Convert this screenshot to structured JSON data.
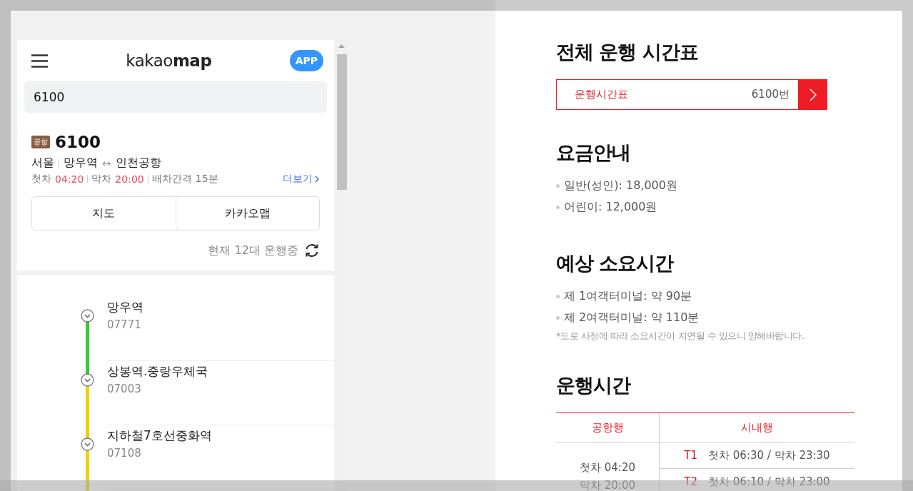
{
  "header": {
    "logo": "kakao**map**",
    "app_button": "APP"
  },
  "search": {
    "value": "6100"
  },
  "route": {
    "badge": "공항",
    "number": "6100",
    "region": "서울",
    "from": "망우역",
    "arrow": "↔",
    "to": "인천공항",
    "schedule": [
      {
        "label": "첫차",
        "value": "04:20",
        "highlight": true
      },
      {
        "label": "막차",
        "value": "20:00",
        "highlight": true
      },
      {
        "label": "배차간격",
        "value": "15분",
        "highlight": false
      }
    ],
    "more": "더보기"
  },
  "buttons": [
    "지도",
    "카카오맵"
  ],
  "status": "현재 12대 운행중",
  "stops": [
    {
      "name": "망우역",
      "id": "07771",
      "color": "#33cc33"
    },
    {
      "name": "상봉역.중랑우체국",
      "id": "07003",
      "color": "#f2d000"
    },
    {
      "name": "지하철7호선중화역",
      "id": "07108",
      "color": "#f2d000"
    }
  ],
  "timetable": {
    "title": "전체 운행 시간표",
    "label": "운행시간표",
    "route": "6100번"
  },
  "fares": {
    "title": "요금안내",
    "items": [
      "일반(성인): 18,000원",
      "어린이: 12,000원"
    ]
  },
  "duration": {
    "title": "예상 소요시간",
    "items": [
      "제 1여객터미널: 약 90분",
      "제 2여객터미널: 약 110분"
    ],
    "note": "*도로 사정에 따라 소요시간이 지연될 수 있으니 양해바랍니다."
  },
  "hours": {
    "title": "운행시간",
    "columns": [
      "공항행",
      "시내행"
    ],
    "airbound": [
      "첫차 04:20",
      "막차 20:00"
    ],
    "citybound": [
      {
        "terminal": "T1",
        "times": "첫차 06:30 / 막차 23:30"
      },
      {
        "terminal": "T2",
        "times": "첫차 06:10 / 막차 23:00"
      }
    ]
  }
}
